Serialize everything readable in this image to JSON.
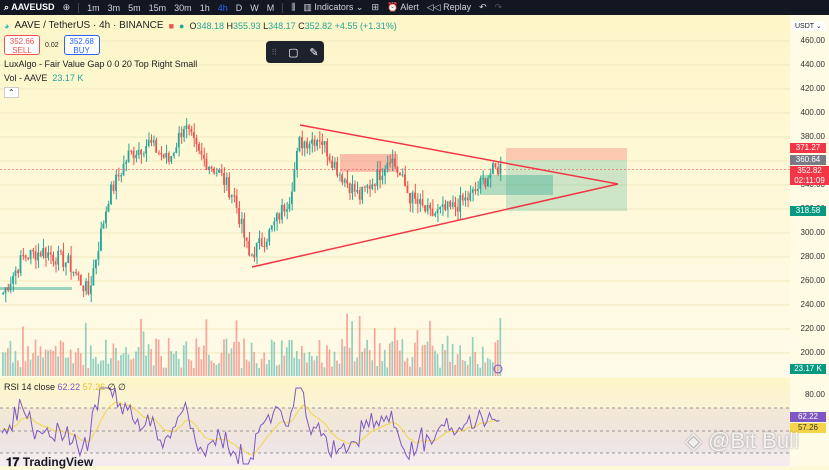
{
  "topbar": {
    "symbol": "AAVEUSD",
    "timeframes": [
      "1m",
      "3m",
      "5m",
      "15m",
      "30m",
      "1h",
      "4h",
      "D",
      "W",
      "M"
    ],
    "active": "4h",
    "indicators": "Indicators",
    "alert": "Alert",
    "replay": "Replay"
  },
  "header": {
    "title": "AAVE / TetherUS · 4h · BINANCE",
    "open_label": "O",
    "open": "348.18",
    "high_label": "H",
    "high": "355.93",
    "low_label": "L",
    "low": "348.17",
    "close_label": "C",
    "close": "352.82",
    "change": "+4.55 (+1.31%)"
  },
  "trade": {
    "sell_price": "352.66",
    "sell_label": "SELL",
    "spread": "0.02",
    "buy_price": "352.68",
    "buy_label": "BUY"
  },
  "indicators": {
    "fvg": "LuxAlgo - Fair Value Gap 0 0 20 Top Right Small",
    "vol_label": "Vol - AAVE",
    "vol_value": "23.17 K",
    "rsi_label": "RSI 14 close",
    "rsi_value": "62.22",
    "rsi_ma": "57.26",
    "rsi_extra": "∅ ∅"
  },
  "axis": {
    "currency": "USDT",
    "ticks": [
      "460.00",
      "440.00",
      "420.00",
      "400.00",
      "380.00",
      "360.00",
      "340.00",
      "320.00",
      "300.00",
      "280.00",
      "260.00",
      "240.00",
      "220.00",
      "200.00"
    ],
    "tick_values": [
      460,
      440,
      420,
      400,
      380,
      360,
      340,
      320,
      300,
      280,
      260,
      240,
      220,
      200
    ],
    "labels": {
      "red_target": "371.27",
      "gray": "360.64",
      "last": "352.82",
      "countdown": "02:11:09",
      "green_target": "318.58",
      "volume": "23.17 K",
      "rsi": "62.22",
      "rsi_ma": "57.26",
      "rsi_80": "80.00"
    }
  },
  "price_keypoints": [
    [
      0,
      250
    ],
    [
      8,
      280
    ],
    [
      16,
      285
    ],
    [
      26,
      275
    ],
    [
      34,
      250
    ],
    [
      42,
      330
    ],
    [
      50,
      365
    ],
    [
      58,
      375
    ],
    [
      66,
      360
    ],
    [
      72,
      390
    ],
    [
      78,
      365
    ],
    [
      86,
      350
    ],
    [
      92,
      330
    ],
    [
      98,
      280
    ],
    [
      106,
      300
    ],
    [
      114,
      330
    ],
    [
      118,
      375
    ],
    [
      126,
      380
    ],
    [
      134,
      350
    ],
    [
      142,
      330
    ],
    [
      150,
      350
    ],
    [
      154,
      365
    ],
    [
      162,
      330
    ],
    [
      170,
      315
    ],
    [
      178,
      320
    ],
    [
      186,
      330
    ],
    [
      194,
      350
    ],
    [
      198,
      355
    ]
  ],
  "colors": {
    "up": "#26a69a",
    "down": "#ef5350",
    "accent": "#2962ff"
  },
  "watermark": "@Bit Bull",
  "brand": "TradingView"
}
